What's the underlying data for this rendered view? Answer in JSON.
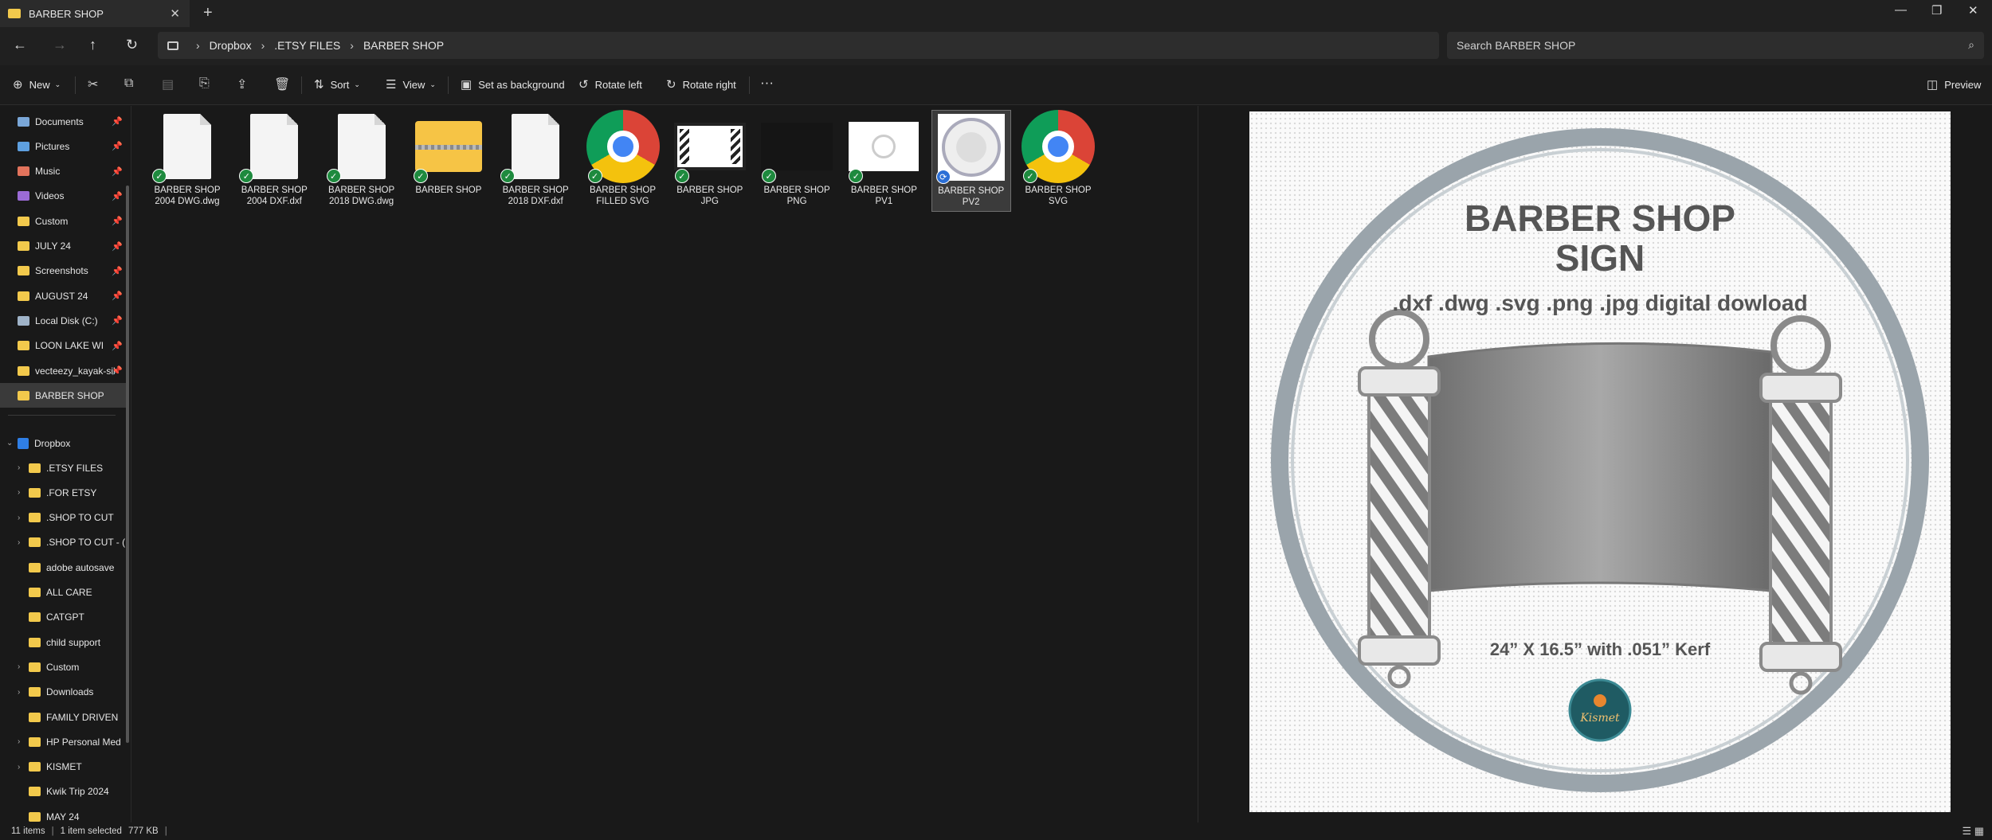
{
  "window": {
    "tab_title": "BARBER SHOP",
    "new_tab": "+",
    "close": "✕",
    "minimize": "—",
    "maximize": "❐",
    "exit": "✕"
  },
  "nav": {
    "back": "←",
    "forward": "→",
    "up": "↑",
    "refresh": "↻",
    "breadcrumb": [
      "Dropbox",
      ".ETSY FILES",
      "BARBER SHOP"
    ],
    "search_placeholder": "Search BARBER SHOP"
  },
  "toolbar": {
    "new_label": "New",
    "sort_label": "Sort",
    "view_label": "View",
    "set_background_label": "Set as background",
    "rotate_left_label": "Rotate left",
    "rotate_right_label": "Rotate right",
    "more_label": "···",
    "preview_label": "Preview"
  },
  "sidebar": {
    "pinned": [
      {
        "label": "Documents",
        "icon": "documents-icon",
        "color": "#7aa7d8"
      },
      {
        "label": "Pictures",
        "icon": "pictures-icon",
        "color": "#5ea0e0"
      },
      {
        "label": "Music",
        "icon": "music-icon",
        "color": "#e2735c"
      },
      {
        "label": "Videos",
        "icon": "videos-icon",
        "color": "#9b6bd6"
      },
      {
        "label": "Custom",
        "icon": "folder-icon",
        "color": "#f2c94c"
      },
      {
        "label": "JULY 24",
        "icon": "folder-icon",
        "color": "#f2c94c"
      },
      {
        "label": "Screenshots",
        "icon": "folder-icon",
        "color": "#f2c94c"
      },
      {
        "label": "AUGUST 24",
        "icon": "folder-icon",
        "color": "#f2c94c"
      },
      {
        "label": "Local Disk (C:)",
        "icon": "drive-icon",
        "color": "#9fb3c8"
      },
      {
        "label": "LOON LAKE WI",
        "icon": "folder-icon",
        "color": "#f2c94c"
      },
      {
        "label": "vecteezy_kayak-sil",
        "icon": "folder-icon",
        "color": "#f2c94c"
      },
      {
        "label": "BARBER SHOP",
        "icon": "folder-icon",
        "color": "#f2c94c"
      }
    ],
    "dropbox_label": "Dropbox",
    "dropbox_items": [
      {
        "label": ".ETSY FILES",
        "expandable": true
      },
      {
        "label": ".FOR ETSY",
        "expandable": true
      },
      {
        "label": ".SHOP TO CUT",
        "expandable": true
      },
      {
        "label": ".SHOP TO CUT - (",
        "expandable": true
      },
      {
        "label": "adobe autosave",
        "expandable": false
      },
      {
        "label": "ALL CARE",
        "expandable": false
      },
      {
        "label": "CATGPT",
        "expandable": false
      },
      {
        "label": "child support",
        "expandable": false
      },
      {
        "label": "Custom",
        "expandable": true
      },
      {
        "label": "Downloads",
        "expandable": true
      },
      {
        "label": "FAMILY DRIVEN",
        "expandable": false
      },
      {
        "label": "HP Personal Med",
        "expandable": true
      },
      {
        "label": "KISMET",
        "expandable": true
      },
      {
        "label": "Kwik Trip 2024",
        "expandable": false
      },
      {
        "label": "MAY 24",
        "expandable": false
      }
    ]
  },
  "files": [
    {
      "line1": "BARBER SHOP",
      "line2": "2004 DWG.dwg",
      "kind": "doc",
      "status": "synced"
    },
    {
      "line1": "BARBER SHOP",
      "line2": "2004 DXF.dxf",
      "kind": "doc",
      "status": "synced"
    },
    {
      "line1": "BARBER SHOP",
      "line2": "2018 DWG.dwg",
      "kind": "doc",
      "status": "synced"
    },
    {
      "line1": "BARBER SHOP",
      "line2": "",
      "kind": "zip-folder",
      "status": "synced"
    },
    {
      "line1": "BARBER SHOP",
      "line2": "2018 DXF.dxf",
      "kind": "doc",
      "status": "synced"
    },
    {
      "line1": "BARBER SHOP",
      "line2": "FILLED SVG",
      "kind": "chrome",
      "status": "synced"
    },
    {
      "line1": "BARBER SHOP",
      "line2": "JPG",
      "kind": "jpg",
      "status": "synced"
    },
    {
      "line1": "BARBER SHOP",
      "line2": "PNG",
      "kind": "png",
      "status": "synced"
    },
    {
      "line1": "BARBER SHOP",
      "line2": "PV1",
      "kind": "pv1",
      "status": "synced"
    },
    {
      "line1": "BARBER SHOP",
      "line2": "PV2",
      "kind": "pv2",
      "status": "syncing"
    },
    {
      "line1": "BARBER SHOP",
      "line2": "SVG",
      "kind": "chrome",
      "status": "synced"
    }
  ],
  "preview": {
    "title_line1": "BARBER SHOP",
    "title_line2": "SIGN",
    "formats": ".dxf .dwg .svg .png .jpg digital dowload",
    "dimensions": "24” X 16.5” with .051” Kerf",
    "logo_text": "Kismet"
  },
  "status": {
    "items": "11 items",
    "selected": "1 item selected",
    "size": "777 KB"
  },
  "colors": {
    "accent": "#2b6fd6",
    "sync_ok": "#1e8a3e",
    "folder": "#f2c94c"
  }
}
